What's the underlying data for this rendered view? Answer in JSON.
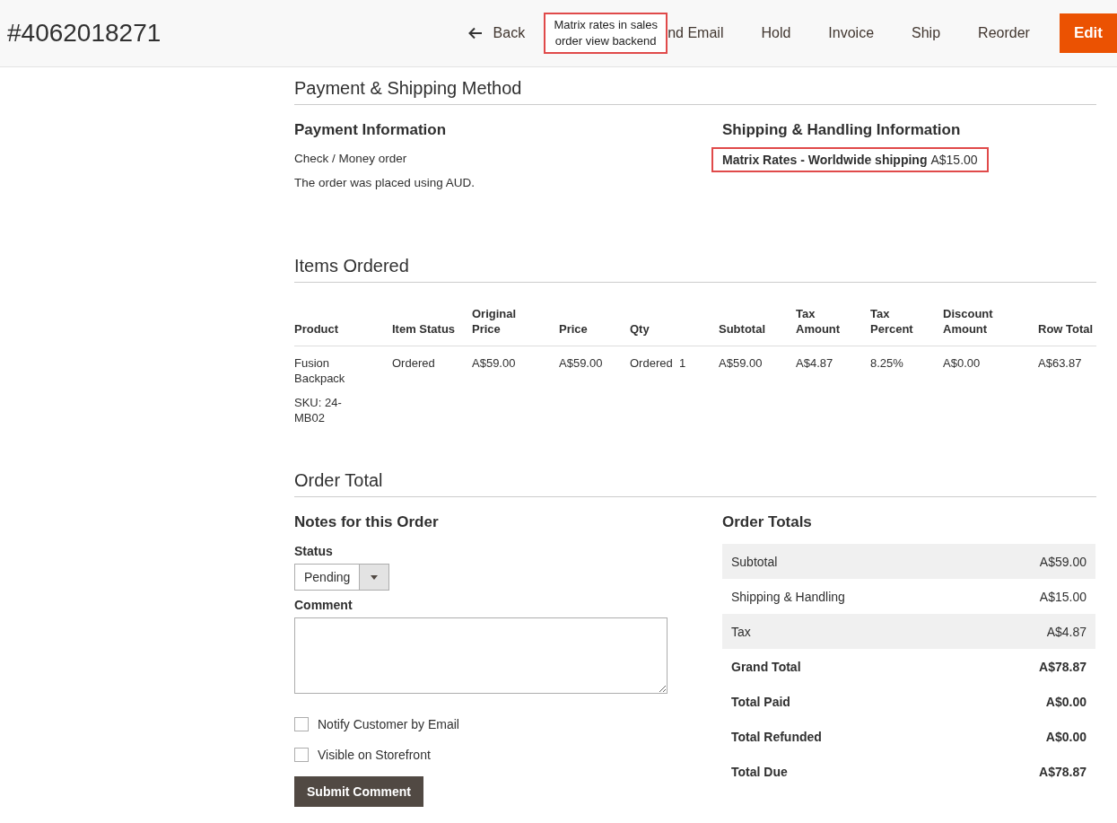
{
  "header": {
    "title": "#4062018271",
    "back": "Back",
    "callout": "Matrix rates in sales order view backend",
    "actions": [
      "nd Email",
      "Hold",
      "Invoice",
      "Ship",
      "Reorder"
    ],
    "primary": "Edit"
  },
  "payment_shipping": {
    "heading": "Payment & Shipping Method",
    "payment": {
      "title": "Payment Information",
      "method": "Check / Money order",
      "note": "The order was placed using AUD."
    },
    "shipping": {
      "title": "Shipping & Handling Information",
      "method": "Matrix Rates - Worldwide shipping",
      "price": "A$15.00"
    }
  },
  "items": {
    "heading": "Items Ordered",
    "columns": [
      "Product",
      "Item Status",
      "Original Price",
      "Price",
      "Qty",
      "Subtotal",
      "Tax Amount",
      "Tax Percent",
      "Discount Amount",
      "Row Total"
    ],
    "rows": [
      {
        "sku": "SKU: 24-MB02",
        "cells": [
          "Fusion Backpack",
          "Ordered",
          "A$59.00",
          "A$59.00",
          "Ordered  1",
          "A$59.00",
          "A$4.87",
          "8.25%",
          "A$0.00",
          "A$63.87"
        ]
      }
    ]
  },
  "order_total": {
    "heading": "Order Total",
    "notes": {
      "title": "Notes for this Order",
      "status_label": "Status",
      "status_value": "Pending",
      "comment_label": "Comment",
      "checkboxes": [
        {
          "label": "Notify Customer by Email",
          "checked": false
        },
        {
          "label": "Visible on Storefront",
          "checked": false
        }
      ],
      "submit": "Submit Comment"
    },
    "totals": {
      "title": "Order Totals",
      "rows": [
        {
          "label": "Subtotal",
          "value": "A$59.00",
          "kind": "plain"
        },
        {
          "label": "Shipping & Handling",
          "value": "A$15.00",
          "kind": "plain"
        },
        {
          "label": "Tax",
          "value": "A$4.87",
          "kind": "plain"
        },
        {
          "label": "Grand Total",
          "value": "A$78.87",
          "kind": "strong"
        },
        {
          "label": "Total Paid",
          "value": "A$0.00",
          "kind": "strong"
        },
        {
          "label": "Total Refunded",
          "value": "A$0.00",
          "kind": "strong"
        },
        {
          "label": "Total Due",
          "value": "A$78.87",
          "kind": "strong"
        }
      ]
    }
  }
}
